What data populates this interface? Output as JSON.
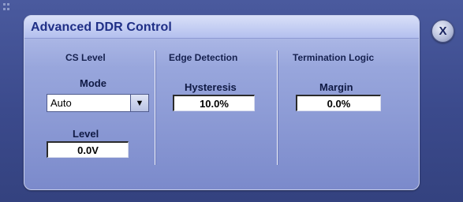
{
  "panel": {
    "title": "Advanced DDR Control"
  },
  "close_button": {
    "label": "X"
  },
  "sections": {
    "cs_level": {
      "title": "CS Level",
      "mode_label": "Mode",
      "mode_value": "Auto",
      "level_label": "Level",
      "level_value": "0.0V"
    },
    "edge_detection": {
      "title": "Edge Detection",
      "hysteresis_label": "Hysteresis",
      "hysteresis_value": "10.0%"
    },
    "termination_logic": {
      "title": "Termination Logic",
      "margin_label": "Margin",
      "margin_value": "0.0%"
    }
  },
  "icons": {
    "dropdown": "chevron-down-icon",
    "close": "close-icon",
    "grip": "drag-grip-icon"
  },
  "colors": {
    "background": "#3b4a8c",
    "panel": "#98a6dc",
    "title": "#1f2f86"
  }
}
